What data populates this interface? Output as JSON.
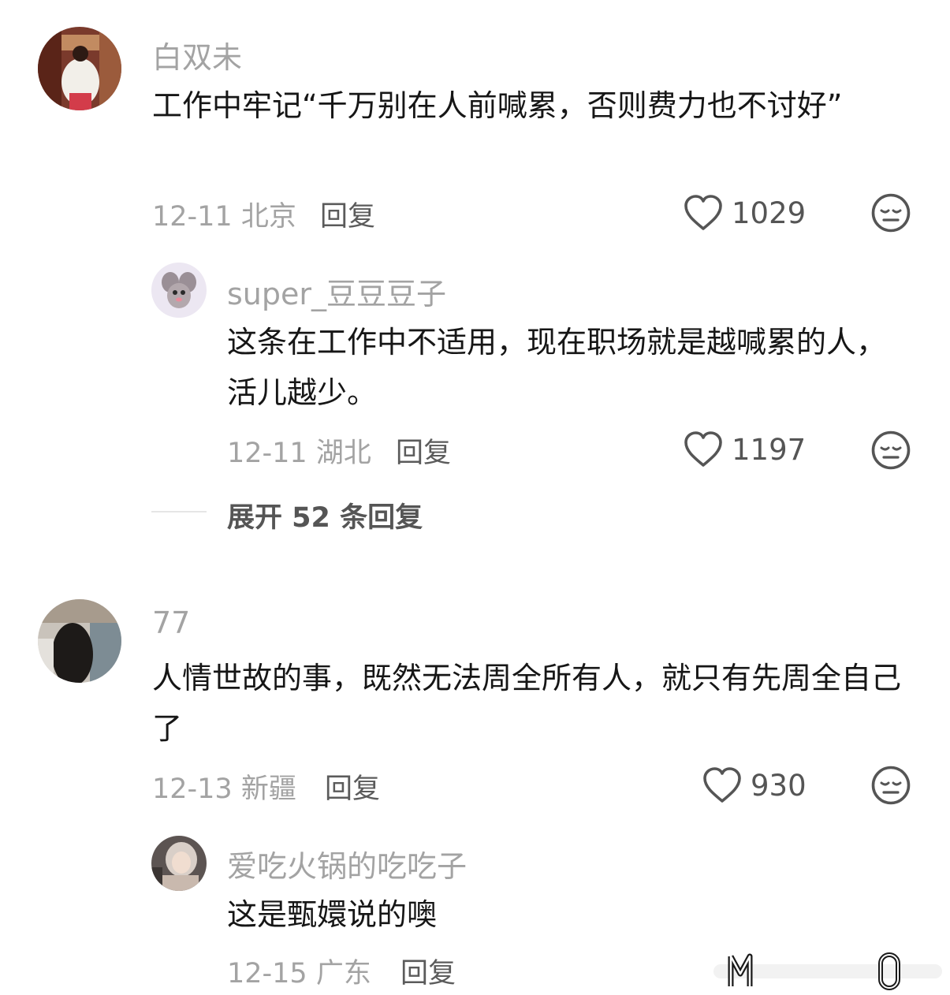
{
  "comments": [
    {
      "username": "白双未",
      "text": "工作中牢记“千万别在人前喊累，否则费力也不讨好”",
      "date": "12-11 北京",
      "reply_label": "回复",
      "likes": "1029",
      "replies": [
        {
          "username": "super_豆豆豆子",
          "text": "这条在工作中不适用，现在职场就是越喊累的人，活儿越少。",
          "date": "12-11 湖北",
          "reply_label": "回复",
          "likes": "1197"
        }
      ],
      "expand_label": "展开 52 条回复"
    },
    {
      "username": "77",
      "text": "人情世故的事，既然无法周全所有人，就只有先周全自己了",
      "date": "12-13 新疆",
      "reply_label": "回复",
      "likes": "930",
      "replies": [
        {
          "username": "爱吃火锅的吃吃子",
          "text": "这是甄嬛说的噢",
          "date": "12-15 广东",
          "reply_label": "回复"
        }
      ]
    }
  ],
  "colors": {
    "text": "#161616",
    "muted": "#a3a3a3",
    "icon": "#555555",
    "background": "#ffffff"
  }
}
